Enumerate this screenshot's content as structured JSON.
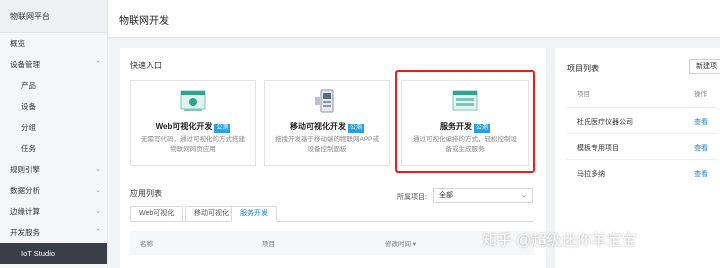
{
  "sidebar": {
    "title": "物联网平台",
    "items": [
      {
        "label": "概览",
        "level": 0,
        "chev": ""
      },
      {
        "label": "设备管理",
        "level": 0,
        "chev": "⌃"
      },
      {
        "label": "产品",
        "level": 1,
        "chev": ""
      },
      {
        "label": "设备",
        "level": 1,
        "chev": ""
      },
      {
        "label": "分组",
        "level": 1,
        "chev": ""
      },
      {
        "label": "任务",
        "level": 1,
        "chev": ""
      },
      {
        "label": "规则引擎",
        "level": 0,
        "chev": "⌄"
      },
      {
        "label": "数据分析",
        "level": 0,
        "chev": "⌄"
      },
      {
        "label": "边缘计算",
        "level": 0,
        "chev": "⌄"
      },
      {
        "label": "开发服务",
        "level": 0,
        "chev": "⌃"
      },
      {
        "label": "IoT Studio",
        "level": 1,
        "chev": "",
        "active": true
      }
    ]
  },
  "header": {
    "title": "物联网开发"
  },
  "quick": {
    "title": "快速入口",
    "cards": [
      {
        "name": "Web可视化开发",
        "badge": "公测",
        "desc": "无需写代码，通过可视化的方式搭建物联网网页应用",
        "icon": "web-visual-icon"
      },
      {
        "name": "移动可视化开发",
        "badge": "公测",
        "desc": "拖拽开发基于移动端的物联网APP或设备控制面板",
        "icon": "mobile-visual-icon"
      },
      {
        "name": "服务开发",
        "badge": "公测",
        "desc": "通过可视化编排的方式，轻松控制设备或生成服务",
        "icon": "service-dev-icon"
      }
    ]
  },
  "apps": {
    "title": "应用列表",
    "filter_label": "所属项目:",
    "filter_value": "全部",
    "tabs": [
      {
        "label": "Web可视化",
        "active": false
      },
      {
        "label": "移动可视化",
        "active": false
      },
      {
        "label": "服务开发",
        "active": true
      }
    ],
    "columns": [
      "名称",
      "项目",
      "修改时间 ▾"
    ]
  },
  "projects": {
    "title": "项目列表",
    "new_button": "新建项",
    "col_project": "项目",
    "col_action": "操作",
    "rows": [
      {
        "name": "杜氏医疗仪器公司",
        "action": "查看"
      },
      {
        "name": "模板专用项目",
        "action": "查看"
      },
      {
        "name": "马拉多纳",
        "action": "查看"
      }
    ]
  },
  "watermark": "知乎 @超级迷你羊宝宝",
  "colors": {
    "accent": "#1e88d8",
    "badge": "#28a0e6",
    "highlight": "#e5201f",
    "sidebar_active": "#3a3f47"
  }
}
